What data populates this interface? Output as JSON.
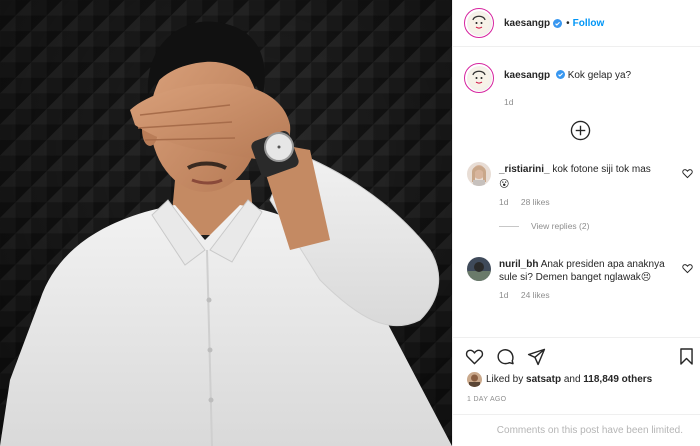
{
  "header": {
    "username": "kaesangp",
    "follow_label": "Follow",
    "separator": "•"
  },
  "caption": {
    "username": "kaesangp",
    "text": "Kok gelap ya?",
    "age": "1d"
  },
  "comments": [
    {
      "username": "_ristiarini_",
      "text": "kok fotone siji tok mas",
      "emoji": "😮",
      "age": "1d",
      "likes": "28 likes",
      "view_replies": "View replies (2)"
    },
    {
      "username": "nuril_bh",
      "text": "Anak presiden apa anaknya sule si? Demen banget nglawak",
      "emoji": "😣",
      "age": "1d",
      "likes": "24 likes"
    }
  ],
  "likes": {
    "prefix": "Liked by",
    "user": "satsatp",
    "joiner": "and",
    "others": "118,849 others"
  },
  "date": "1 DAY AGO",
  "comments_limited": "Comments on this post have been limited.",
  "icons": {
    "verified": "verified-badge-icon",
    "load_more": "plus-circle-icon",
    "like": "heart-icon",
    "comment": "comment-bubble-icon",
    "share": "paper-plane-icon",
    "save": "bookmark-icon"
  },
  "colors": {
    "follow": "#0095f6",
    "verified": "#3897f0",
    "muted": "#8e8e8e",
    "limited": "#b5b5b5",
    "story_ring": "#d6249f"
  }
}
